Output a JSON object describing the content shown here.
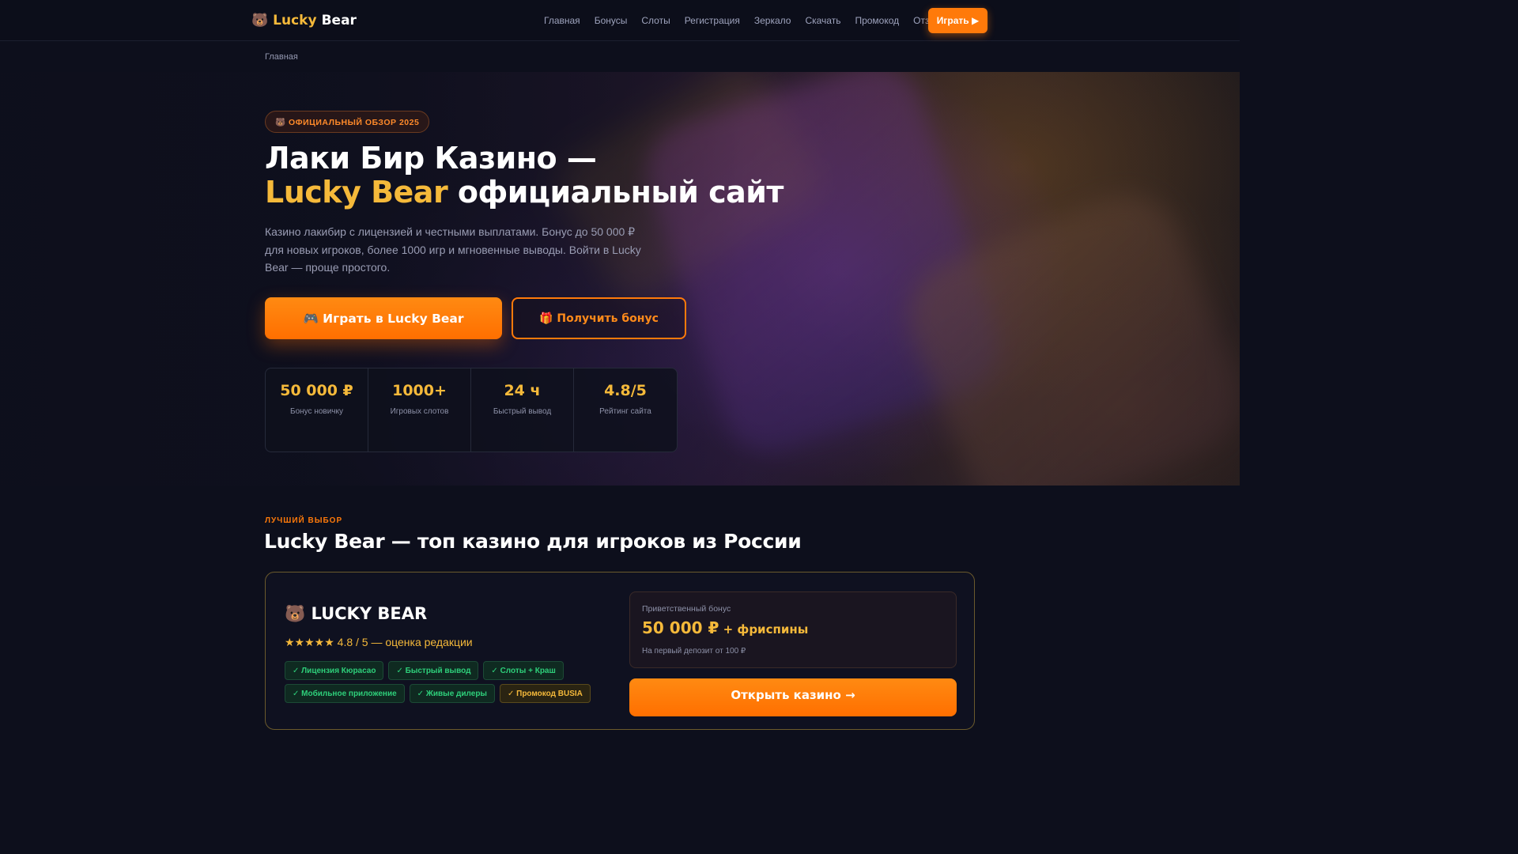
{
  "header": {
    "logo_icon": "bear-emoji",
    "logo_lucky": "Lucky",
    "logo_bear": "Bear",
    "nav": [
      "Главная",
      "Бонусы",
      "Слоты",
      "Регистрация",
      "Зеркало",
      "Скачать",
      "Промокод",
      "Отзывы"
    ],
    "play_label": "Играть ▶"
  },
  "breadcrumb": "Главная",
  "hero": {
    "badge": "🐻 ОФИЦИАЛЬНЫЙ ОБЗОР 2025",
    "title_line1": "Лаки Бир Казино —",
    "title_highlight": "Lucky Bear",
    "title_rest": " официальный сайт",
    "lead": "Казино лакибир с лицензией и честными выплатами. Бонус до 50 000 ₽ для новых игроков, более 1000 игр и мгновенные выводы. Войти в Lucky Bear — проще простого.",
    "primary_button": "🎮 Играть в Lucky Bear",
    "secondary_button": "🎁 Получить бонус",
    "stats": [
      {
        "value": "50 000 ₽",
        "label": "Бонус новичку"
      },
      {
        "value": "1000+",
        "label": "Игровых слотов"
      },
      {
        "value": "24 ч",
        "label": "Быстрый вывод"
      },
      {
        "value": "4.8/5",
        "label": "Рейтинг сайта"
      }
    ]
  },
  "section": {
    "eyebrow": "ЛУЧШИЙ ВЫБОР",
    "title": "Lucky Bear — топ казино для игроков из России"
  },
  "card": {
    "brand": "🐻 LUCKY BEAR",
    "stars": "★★★★★",
    "rating": " 4.8 / 5 — оценка редакции",
    "tags": [
      "✓ Лицензия Кюрасао",
      "✓ Быстрый вывод",
      "✓ Слоты + Краш",
      "✓ Мобильное приложение",
      "✓ Живые дилеры"
    ],
    "promo_tag": "✓ Промокод BUSIA",
    "bonus_label": "Приветственный бонус",
    "bonus_value": "50 000 ₽",
    "bonus_plus": " + фриспины",
    "bonus_note": "На первый депозит от 100 ₽",
    "open_button": "Открыть казино →"
  },
  "colors": {
    "accent": "#ff7a0a",
    "gold": "#f5b93a",
    "background": "#0d0f1c",
    "tag_green": "#2ecf7a"
  }
}
